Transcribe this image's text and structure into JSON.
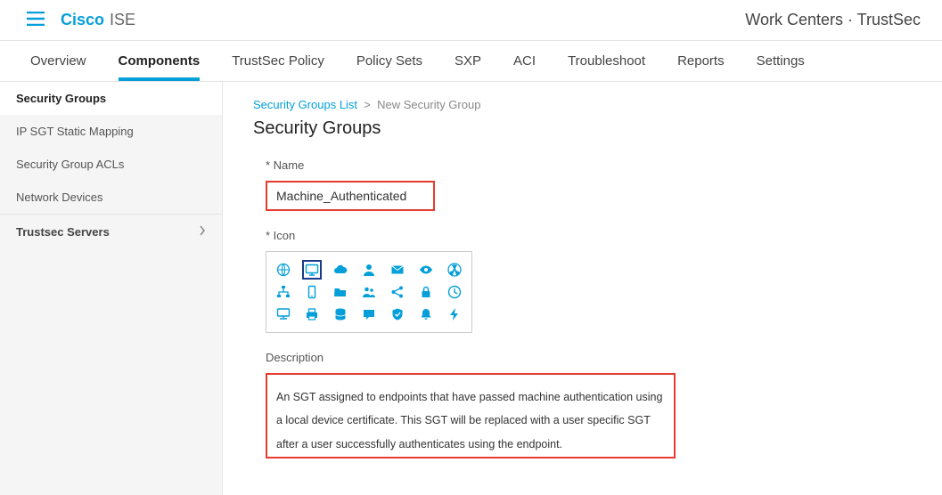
{
  "brand": {
    "main": "Cisco",
    "sub": "ISE"
  },
  "header_path": "Work Centers · TrustSec",
  "tabs": [
    {
      "label": "Overview"
    },
    {
      "label": "Components"
    },
    {
      "label": "TrustSec Policy"
    },
    {
      "label": "Policy Sets"
    },
    {
      "label": "SXP"
    },
    {
      "label": "ACI"
    },
    {
      "label": "Troubleshoot"
    },
    {
      "label": "Reports"
    },
    {
      "label": "Settings"
    }
  ],
  "active_tab": 1,
  "sidebar": {
    "items": [
      {
        "label": "Security Groups"
      },
      {
        "label": "IP SGT Static Mapping"
      },
      {
        "label": "Security Group ACLs"
      },
      {
        "label": "Network Devices"
      }
    ],
    "active": 0,
    "section": {
      "label": "Trustsec Servers"
    }
  },
  "breadcrumb": {
    "parent": "Security Groups List",
    "current": "New Security Group"
  },
  "page_title": "Security Groups",
  "form": {
    "name_label": "* Name",
    "name_value": "Machine_Authenticated",
    "icon_label": "* Icon",
    "icon_selected": 1,
    "icons": [
      [
        "globe-icon",
        "monitor-icon",
        "cloud-icon",
        "person-icon",
        "mail-icon",
        "eye-icon",
        "radiation-icon"
      ],
      [
        "sitemap-icon",
        "mobile-icon",
        "folder-icon",
        "users-icon",
        "share-icon",
        "lock-icon",
        "clock-icon"
      ],
      [
        "computer-icon",
        "printer-icon",
        "database-icon",
        "chat-icon",
        "shield-icon",
        "bell-icon",
        "bolt-icon"
      ]
    ],
    "description_label": "Description",
    "description_value": "An SGT assigned to endpoints that have passed machine authentication using a local device certificate. This SGT will be replaced with a user specific SGT after a user successfully authenticates using the endpoint."
  }
}
